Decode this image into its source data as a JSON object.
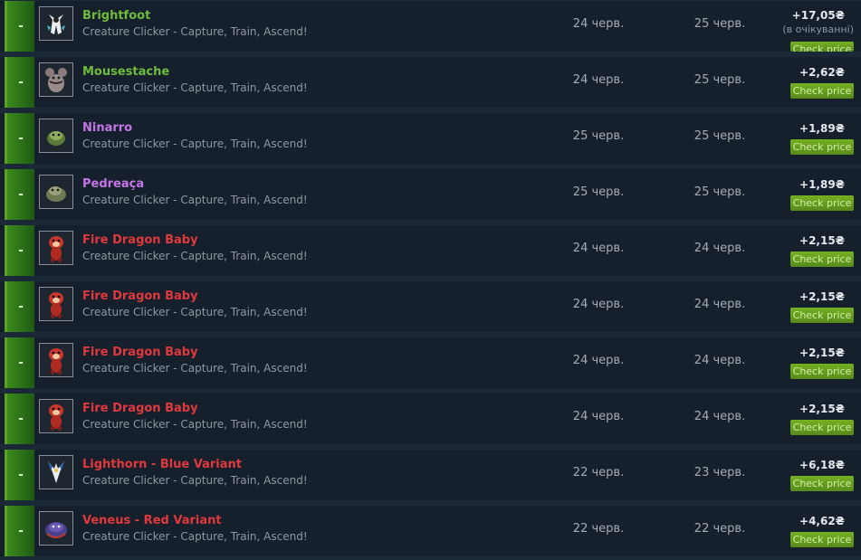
{
  "items": [
    {
      "name": "Brightfoot",
      "rarity": "green",
      "game": "Creature Clicker - Capture, Train, Ascend!",
      "date1": "24 черв.",
      "date2": "25 черв.",
      "price": "+17,05₴",
      "pending": "(в очікуванні)",
      "check": "Check price",
      "minus": "-",
      "icon": "brightfoot-creature-icon"
    },
    {
      "name": "Mousestache",
      "rarity": "green",
      "game": "Creature Clicker - Capture, Train, Ascend!",
      "date1": "24 черв.",
      "date2": "25 черв.",
      "price": "+2,62₴",
      "check": "Check price",
      "minus": "-",
      "icon": "mousestache-creature-icon"
    },
    {
      "name": "Ninarro",
      "rarity": "purple",
      "game": "Creature Clicker - Capture, Train, Ascend!",
      "date1": "25 черв.",
      "date2": "25 черв.",
      "price": "+1,89₴",
      "check": "Check price",
      "minus": "-",
      "icon": "ninarro-creature-icon"
    },
    {
      "name": "Pedreaça",
      "rarity": "purple",
      "game": "Creature Clicker - Capture, Train, Ascend!",
      "date1": "25 черв.",
      "date2": "25 черв.",
      "price": "+1,89₴",
      "check": "Check price",
      "minus": "-",
      "icon": "pedreaca-creature-icon"
    },
    {
      "name": "Fire Dragon Baby",
      "rarity": "red",
      "game": "Creature Clicker - Capture, Train, Ascend!",
      "date1": "24 черв.",
      "date2": "24 черв.",
      "price": "+2,15₴",
      "check": "Check price",
      "minus": "-",
      "icon": "fire-dragon-baby-icon"
    },
    {
      "name": "Fire Dragon Baby",
      "rarity": "red",
      "game": "Creature Clicker - Capture, Train, Ascend!",
      "date1": "24 черв.",
      "date2": "24 черв.",
      "price": "+2,15₴",
      "check": "Check price",
      "minus": "-",
      "icon": "fire-dragon-baby-icon"
    },
    {
      "name": "Fire Dragon Baby",
      "rarity": "red",
      "game": "Creature Clicker - Capture, Train, Ascend!",
      "date1": "24 черв.",
      "date2": "24 черв.",
      "price": "+2,15₴",
      "check": "Check price",
      "minus": "-",
      "icon": "fire-dragon-baby-icon"
    },
    {
      "name": "Fire Dragon Baby",
      "rarity": "red",
      "game": "Creature Clicker - Capture, Train, Ascend!",
      "date1": "24 черв.",
      "date2": "24 черв.",
      "price": "+2,15₴",
      "check": "Check price",
      "minus": "-",
      "icon": "fire-dragon-baby-icon"
    },
    {
      "name": "Lighthorn - Blue Variant",
      "rarity": "red",
      "game": "Creature Clicker - Capture, Train, Ascend!",
      "date1": "22 черв.",
      "date2": "23 черв.",
      "price": "+6,18₴",
      "check": "Check price",
      "minus": "-",
      "icon": "lighthorn-creature-icon"
    },
    {
      "name": "Veneus - Red Variant",
      "rarity": "red",
      "game": "Creature Clicker - Capture, Train, Ascend!",
      "date1": "22 черв.",
      "date2": "22 черв.",
      "price": "+4,62₴",
      "check": "Check price",
      "minus": "-",
      "icon": "veneus-creature-icon"
    }
  ],
  "colors": {
    "background": "#1b2838",
    "row_background": "#16202d",
    "accent_green": "#5ea323",
    "rarity_green": "#6fbc3c",
    "rarity_purple": "#c476e8",
    "rarity_red": "#e0393d",
    "button_green": "#75b022"
  }
}
